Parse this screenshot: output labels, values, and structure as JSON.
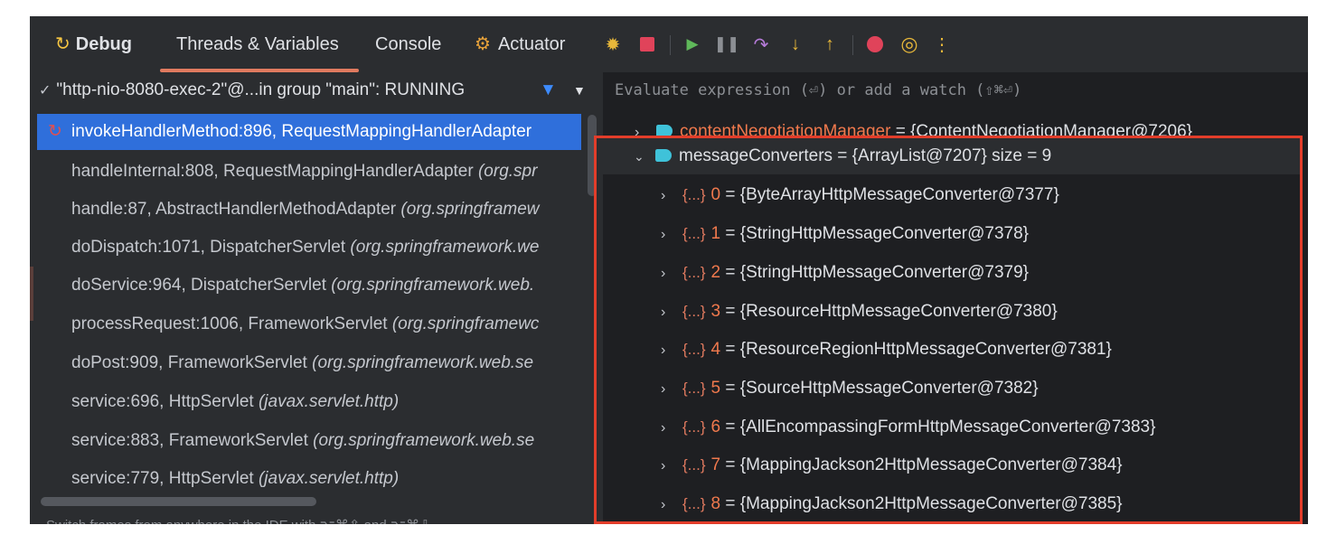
{
  "tabs": {
    "debug": "Debug",
    "threads": "Threads & Variables",
    "console": "Console",
    "actuator": "Actuator"
  },
  "toolbar": {
    "icons": [
      "bug-icon",
      "stop-icon",
      "resume-icon",
      "pause-icon",
      "step-over-icon",
      "step-into-icon",
      "step-out-icon",
      "breakpoint-icon",
      "mute-breakpoints-icon",
      "more-icon"
    ]
  },
  "thread": {
    "label": "\"http-nio-8080-exec-2\"@...in group \"main\": RUNNING"
  },
  "frames": [
    {
      "method": "invokeHandlerMethod:896, RequestMappingHandlerAdapter",
      "pkg": ""
    },
    {
      "method": "handleInternal:808, RequestMappingHandlerAdapter ",
      "pkg": "(org.spr"
    },
    {
      "method": "handle:87, AbstractHandlerMethodAdapter ",
      "pkg": "(org.springframew"
    },
    {
      "method": "doDispatch:1071, DispatcherServlet ",
      "pkg": "(org.springframework.we"
    },
    {
      "method": "doService:964, DispatcherServlet ",
      "pkg": "(org.springframework.web."
    },
    {
      "method": "processRequest:1006, FrameworkServlet ",
      "pkg": "(org.springframewc"
    },
    {
      "method": "doPost:909, FrameworkServlet ",
      "pkg": "(org.springframework.web.se"
    },
    {
      "method": "service:696, HttpServlet ",
      "pkg": "(javax.servlet.http)"
    },
    {
      "method": "service:883, FrameworkServlet ",
      "pkg": "(org.springframework.web.se"
    },
    {
      "method": "service:779, HttpServlet ",
      "pkg": "(javax.servlet.http)"
    }
  ],
  "status_text": "Switch frames from anywhere in the IDE with ⌥⌘⇧ and ⌥⌘⇩",
  "evaluate": {
    "placeholder": "Evaluate expression (⏎) or add a watch (⇧⌘⏎)"
  },
  "variables": {
    "content_negotiation": {
      "name": "contentNegotiationManager",
      "value": " = {ContentNegotiationManager@7206}"
    },
    "message_converters": {
      "name": "messageConverters",
      "value": " = {ArrayList@7207}  size = 9"
    },
    "brace_label": "{...}",
    "items": [
      {
        "index": "0",
        "value": " = {ByteArrayHttpMessageConverter@7377}"
      },
      {
        "index": "1",
        "value": " = {StringHttpMessageConverter@7378}"
      },
      {
        "index": "2",
        "value": " = {StringHttpMessageConverter@7379}"
      },
      {
        "index": "3",
        "value": " = {ResourceHttpMessageConverter@7380}"
      },
      {
        "index": "4",
        "value": " = {ResourceRegionHttpMessageConverter@7381}"
      },
      {
        "index": "5",
        "value": " = {SourceHttpMessageConverter@7382}"
      },
      {
        "index": "6",
        "value": " = {AllEncompassingFormHttpMessageConverter@7383}"
      },
      {
        "index": "7",
        "value": " = {MappingJackson2HttpMessageConverter@7384}"
      },
      {
        "index": "8",
        "value": " = {MappingJackson2HttpMessageConverter@7385}"
      }
    ]
  },
  "colors": {
    "accent": "#e07a5f",
    "selection": "#2f6fdb",
    "highlight_box": "#e23d2a"
  }
}
